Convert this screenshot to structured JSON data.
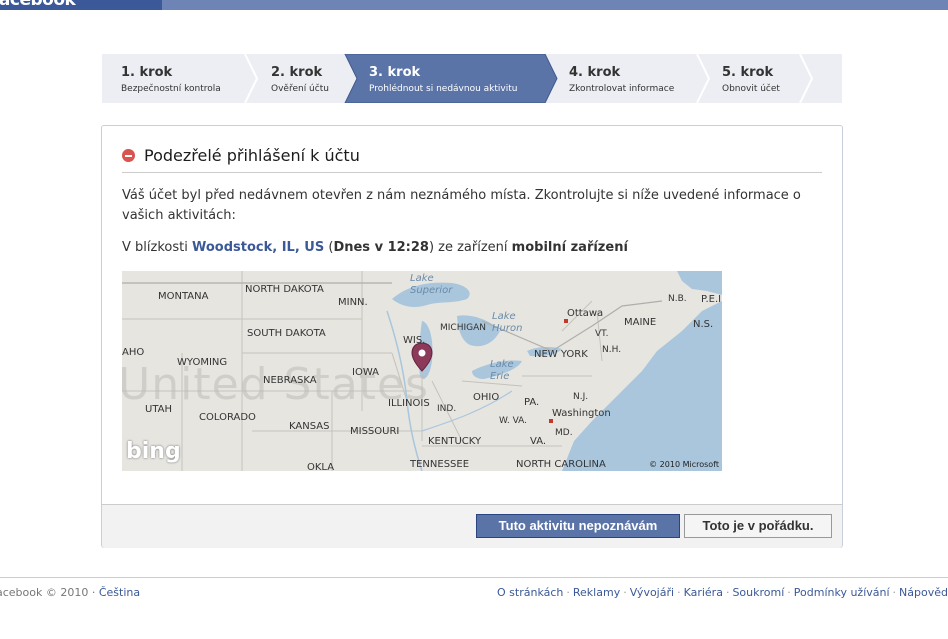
{
  "header": {
    "logo_text": "facebook"
  },
  "steps": [
    {
      "num": "1. krok",
      "sub": "Bezpečnostní kontrola",
      "active": false
    },
    {
      "num": "2. krok",
      "sub": "Ověření účtu",
      "active": false
    },
    {
      "num": "3. krok",
      "sub": "Prohlédnout si nedávnou aktivitu",
      "active": true
    },
    {
      "num": "4. krok",
      "sub": "Zkontrolovat informace",
      "active": false
    },
    {
      "num": "5. krok",
      "sub": "Obnovit účet",
      "active": false
    }
  ],
  "card": {
    "title": "Podezřelé přihlášení k účtu",
    "paragraph": "Váš účet byl před nedávnem otevřen z nám neznámého místa. Zkontrolujte si níže uvedené informace o vašich aktivitách:",
    "location": {
      "prefix": "V blízkosti ",
      "city": "Woodstock, IL, US",
      "open_paren": " (",
      "time": "Dnes v 12:28",
      "mid": ") ze zařízení ",
      "device": "mobilní zařízení"
    },
    "map": {
      "bing_logo": "bing",
      "copyright": "© 2010 Microsoft",
      "watermark": "United States",
      "labels": {
        "montana": "MONTANA",
        "north_dakota": "NORTH DAKOTA",
        "minn": "MINN.",
        "lake_superior": "Lake Superior",
        "ottawa": "Ottawa",
        "nb": "N.B.",
        "pei": "P.E.I.",
        "south_dakota": "SOUTH DAKOTA",
        "idaho": "AHO",
        "wyoming": "WYOMING",
        "wis": "WIS.",
        "michigan": "MICHIGAN",
        "lake_huron": "Lake Huron",
        "vt": "VT.",
        "maine": "MAINE",
        "ns": "N.S.",
        "nh": "N.H.",
        "new_york": "NEW YORK",
        "nebraska": "NEBRASKA",
        "iowa": "IOWA",
        "lake_erie": "Lake Erie",
        "utah": "UTAH",
        "illinois": "ILLINOIS",
        "ind": "IND.",
        "ohio": "OHIO",
        "pa": "PA.",
        "nj": "N.J.",
        "colorado": "COLORADO",
        "washington": "Washington",
        "wva": "W. VA.",
        "md": "MD.",
        "kansas": "KANSAS",
        "missouri": "MISSOURI",
        "kentucky": "KENTUCKY",
        "va": "VA.",
        "oklahoma": "OKLA",
        "tennessee": "TENNESSEE",
        "north_carolina": "NORTH CAROLINA"
      }
    },
    "buttons": {
      "deny": "Tuto aktivitu nepoznávám",
      "confirm": "Toto je v pořádku."
    }
  },
  "footer": {
    "copyright": "acebook © 2010 · ",
    "language": "Čeština",
    "links": [
      "O stránkách",
      "Reklamy",
      "Vývojáři",
      "Kariéra",
      "Soukromí",
      "Podmínky užívání",
      "Nápověd"
    ]
  },
  "colors": {
    "brand": "#3b5998",
    "topbar": "#6d84b4",
    "active_step": "#5b74a8",
    "warning": "#d9534f"
  }
}
